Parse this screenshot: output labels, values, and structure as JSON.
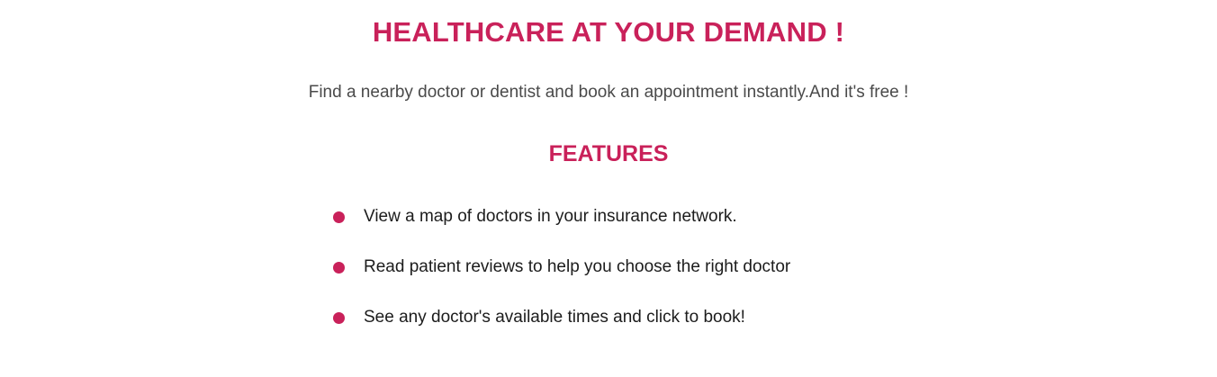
{
  "hero": {
    "title": "HEALTHCARE AT YOUR DEMAND !",
    "subtitle": "Find a nearby doctor or dentist and book an appointment instantly.And it's free !"
  },
  "features": {
    "heading": "FEATURES",
    "items": [
      {
        "text": "View a map of doctors in your insurance network."
      },
      {
        "text": "Read patient reviews to help you choose the right doctor"
      },
      {
        "text": "See any doctor's available times and click to book!"
      }
    ]
  },
  "colors": {
    "accent": "#c9215a",
    "subtitle_text": "#4a4a4a",
    "body_text": "#1c1c1c",
    "background": "#ffffff"
  },
  "icons": {
    "bullet": "bullet-dot-icon"
  }
}
